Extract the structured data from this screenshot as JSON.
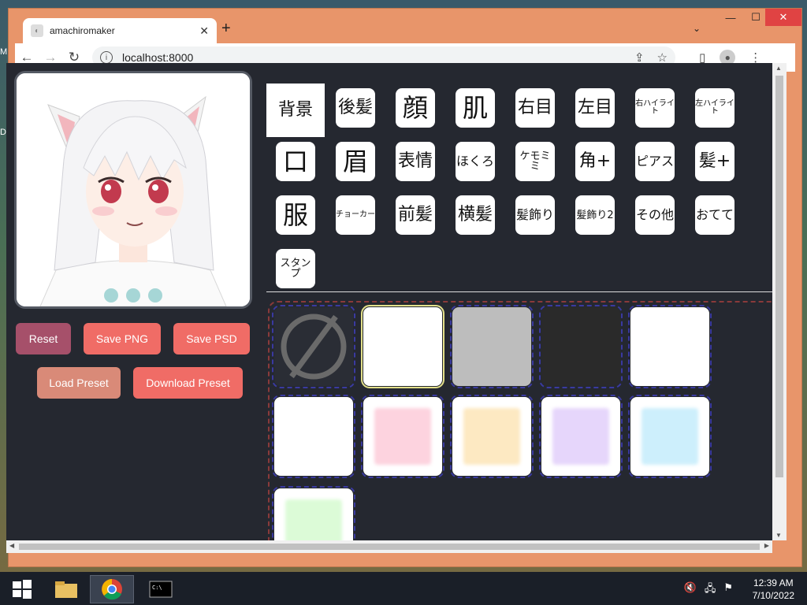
{
  "browser": {
    "tab_title": "amachiromaker",
    "url": "localhost:8000"
  },
  "buttons": {
    "reset": "Reset",
    "save_png": "Save PNG",
    "save_psd": "Save PSD",
    "load_preset": "Load Preset",
    "download_preset": "Download Preset"
  },
  "categories": [
    {
      "label": "背景"
    },
    {
      "label": "後髪"
    },
    {
      "label": "顔"
    },
    {
      "label": "肌"
    },
    {
      "label": "右目"
    },
    {
      "label": "左目"
    },
    {
      "label": "右ハイライト"
    },
    {
      "label": "左ハイライト"
    },
    {
      "label": "口"
    },
    {
      "label": "眉"
    },
    {
      "label": "表情"
    },
    {
      "label": "ほくろ"
    },
    {
      "label": "ケモミミ"
    },
    {
      "label": "角+"
    },
    {
      "label": "ピアス"
    },
    {
      "label": "髪+"
    },
    {
      "label": "服"
    },
    {
      "label": "チョーカー"
    },
    {
      "label": "前髪"
    },
    {
      "label": "横髪"
    },
    {
      "label": "髪飾り"
    },
    {
      "label": "髪飾り2"
    },
    {
      "label": "その他"
    },
    {
      "label": "おてて"
    },
    {
      "label": "スタンプ"
    }
  ],
  "swatch_colors": [
    "#ffffff",
    "#bdbdbd",
    "#2a2a2a",
    "#ffffff",
    "#ffffff",
    "#fdd3df",
    "#fde9c2",
    "#e6d6fb",
    "#cdeffc",
    "#dcfbd7"
  ],
  "taskbar": {
    "time": "12:39 AM",
    "date": "7/10/2022"
  },
  "desktop_letters": [
    "M",
    "D"
  ]
}
